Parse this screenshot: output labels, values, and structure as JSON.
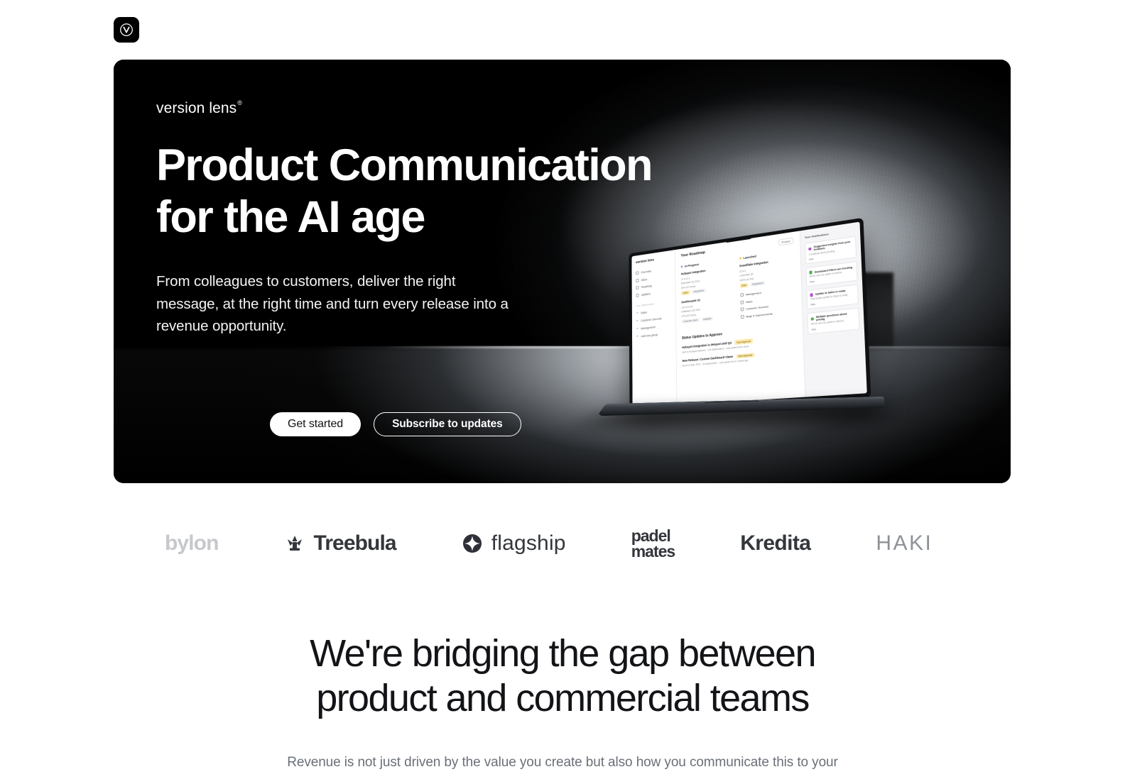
{
  "brand": {
    "mark_icon": "circled-v-logo",
    "wordmark": "version lens",
    "wordmark_suffix": "®"
  },
  "hero": {
    "title_line1": "Product Communication",
    "title_line2": "for the AI age",
    "subtitle": "From colleagues to customers, deliver the right message, at the right time and turn every release into a revenue opportunity.",
    "primary_cta": "Get started",
    "secondary_cta": "Subscribe to updates",
    "background_color": "#000000",
    "mockup": {
      "app_brand": "version lens",
      "sidebar": {
        "items": [
          {
            "label": "Overview",
            "icon": "grid-icon"
          },
          {
            "label": "Inbox",
            "icon": "inbox-icon"
          },
          {
            "label": "Roadmap",
            "icon": "map-icon"
          },
          {
            "label": "Updates",
            "icon": "bell-icon"
          }
        ],
        "group_label": "Your Stakeholders",
        "groups": [
          {
            "label": "Sales"
          },
          {
            "label": "Customer Success"
          },
          {
            "label": "Management"
          },
          {
            "label": "Add new group"
          }
        ]
      },
      "main": {
        "heading": "Your Roadmap",
        "filter_chip": "Product",
        "columns": [
          {
            "label": "In-Progress",
            "dot_color": "#9b8cf5",
            "cards": [
              {
                "title": "Hubspot Integration",
                "meta1": "27   A 12   3",
                "meta2": "Estimated: Q2 2024",
                "meta3": "64% (12 hours)",
                "badges": [
                  "Sales",
                  "Integrations"
                ]
              },
              {
                "title": "Dashboards V2",
                "meta1": "137   A 44   26",
                "meta2": "Estimated: Q2 2024",
                "meta3": "37% (22 hours)",
                "badges": [
                  "Customer Value",
                  "Analytics"
                ]
              }
            ]
          },
          {
            "label": "Launched",
            "dot_color": "#f0c341",
            "cards": [
              {
                "title": "Snowflake Integration",
                "meta1": "12   A 3",
                "meta2": "Launched: Q1",
                "meta3": "100% (11 hrs)",
                "badges": [
                  "Data",
                  "Integrations"
                ]
              }
            ],
            "tags": [
              {
                "label": "Management",
                "icon": "briefcase-icon"
              },
              {
                "label": "Sales",
                "icon": "chart-icon"
              },
              {
                "label": "Customer Success",
                "icon": "check-icon"
              },
              {
                "label": "Bugs & Improvements",
                "icon": "wrench-icon"
              }
            ]
          }
        ],
        "updates_heading": "Status Updates to Approve",
        "updates": [
          {
            "title": "Hubspot integration is delayed until Q4",
            "badge": "Need Approval",
            "meta": "Sent to Hubspot watchers · 103 Stakeholders · Last update 6min. Now!"
          },
          {
            "title": "New Release: Custom Dashboard Views",
            "badge": "Need Approval",
            "meta": "Sent to Public, RCD · 25 stakeholders · Last update 6m in 2 week ago"
          }
        ]
      },
      "notifications": {
        "heading": "Your Notifications",
        "items": [
          {
            "title": "Suggested insights from your feedback",
            "body": "4 feedback items pending",
            "link": "View",
            "icon_color": "#b24fd0"
          },
          {
            "title": "Dashboard Filters are trending",
            "body": "We've seen an uptick in interest",
            "link": "View",
            "icon_color": "#4caf50"
          },
          {
            "title": "Update to Sales is ready",
            "body": "This weekly update to Sales is ready",
            "link": "View",
            "icon_color": "#b24fd0"
          },
          {
            "title": "Multiple questions about pricing",
            "body": "We've seen an uptick in interest",
            "link": "View",
            "icon_color": "#4caf50"
          }
        ]
      }
    }
  },
  "logos": [
    {
      "name": "bylon",
      "style": "faded",
      "icon": null
    },
    {
      "name": "Treebula",
      "style": "bold",
      "icon": "tree-burst-icon"
    },
    {
      "name": "flagship",
      "style": "thin",
      "icon": "star-circle-icon"
    },
    {
      "name_line1": "padel",
      "name_line2": "mates",
      "style": "stacked",
      "icon": null
    },
    {
      "name": "Kredita",
      "style": "bold",
      "icon": null
    },
    {
      "name": "HAKI",
      "style": "wide-faded",
      "icon": null
    }
  ],
  "section": {
    "title_line1": "We're bridging the gap between",
    "title_line2": "product and commercial teams",
    "body": "Revenue is not just driven by the value you create but also how you communicate this to your"
  }
}
